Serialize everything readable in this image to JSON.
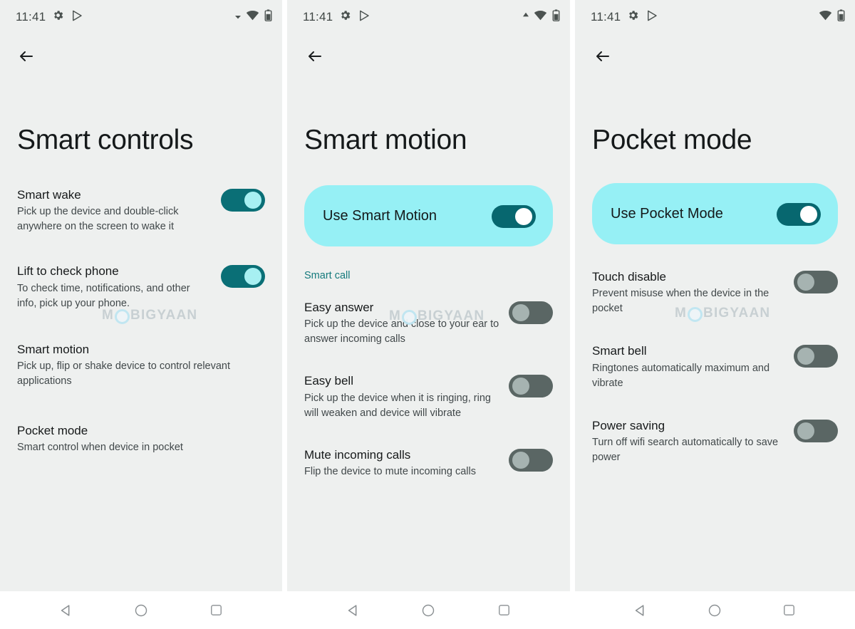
{
  "statusbar": {
    "time": "11:41",
    "left_icons": [
      "gear-icon",
      "play-store-icon"
    ],
    "right_icons_p1": [
      "signal-caret-icon",
      "wifi-icon",
      "battery-icon"
    ],
    "right_icons_p2": [
      "signal-caret-icon",
      "wifi-icon",
      "battery-icon"
    ],
    "right_icons_p3": [
      "wifi-icon",
      "battery-icon"
    ]
  },
  "watermark": {
    "before": "M",
    "after": "BIGYAAN"
  },
  "navbar": {
    "back_label": "Back",
    "home_label": "Home",
    "recents_label": "Recents"
  },
  "colors": {
    "screen_bg": "#eef0ef",
    "accent_teal": "#0a6f76",
    "card_highlight": "#96f0f5",
    "knob_on": "#a7f0f2",
    "toggle_off_track": "#5a6664",
    "toggle_off_knob": "#a6b3b1",
    "section_header": "#157a7c",
    "title_text": "#15191a",
    "body_text": "#41484a"
  },
  "screen1": {
    "title": "Smart controls",
    "items": [
      {
        "title": "Smart wake",
        "subtitle": "Pick up the device and double-click anywhere on the screen to wake it",
        "has_toggle": true,
        "state": "on"
      },
      {
        "title": "Lift to check phone",
        "subtitle": "To check time, notifications, and other info, pick up your phone.",
        "has_toggle": true,
        "state": "on"
      },
      {
        "title": "Smart motion",
        "subtitle": "Pick up, flip or shake device to control relevant applications",
        "has_toggle": false,
        "state": ""
      },
      {
        "title": "Pocket mode",
        "subtitle": "Smart control when device in pocket",
        "has_toggle": false,
        "state": ""
      }
    ]
  },
  "screen2": {
    "title": "Smart motion",
    "master": {
      "label": "Use Smart Motion",
      "state": "on"
    },
    "section_header": "Smart call",
    "items": [
      {
        "title": "Easy answer",
        "subtitle": "Pick up the device and close to your ear to answer incoming calls",
        "has_toggle": true,
        "state": "off"
      },
      {
        "title": "Easy bell",
        "subtitle": "Pick up the device when it is ringing, ring will weaken and device will vibrate",
        "has_toggle": true,
        "state": "off"
      },
      {
        "title": "Mute incoming calls",
        "subtitle": "Flip the device to mute incoming calls",
        "has_toggle": true,
        "state": "off"
      }
    ]
  },
  "screen3": {
    "title": "Pocket mode",
    "master": {
      "label": "Use Pocket Mode",
      "state": "on"
    },
    "items": [
      {
        "title": "Touch disable",
        "subtitle": "Prevent misuse when the device in the pocket",
        "has_toggle": true,
        "state": "off"
      },
      {
        "title": "Smart bell",
        "subtitle": "Ringtones automatically maximum and vibrate",
        "has_toggle": true,
        "state": "off"
      },
      {
        "title": "Power saving",
        "subtitle": "Turn off wifi search automatically to save power",
        "has_toggle": true,
        "state": "off"
      }
    ]
  }
}
